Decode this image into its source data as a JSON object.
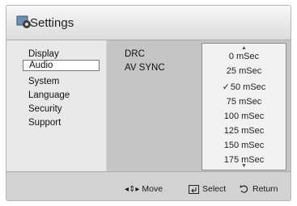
{
  "title": "Settings",
  "menu": {
    "items": [
      "Display",
      "Audio",
      "System",
      "Language",
      "Security",
      "Support"
    ],
    "selected": "Audio"
  },
  "settings": {
    "labels": [
      "DRC",
      "AV SYNC"
    ]
  },
  "dropdown": {
    "options": [
      "0 mSec",
      "25 mSec",
      "50 mSec",
      "75 mSec",
      "100 mSec",
      "125 mSec",
      "150 mSec",
      "175 mSec"
    ],
    "checked": "50 mSec",
    "check_mark": "✓",
    "up_arrow": "▲",
    "down_arrow": "▼"
  },
  "footer": {
    "move_icon": "◂⇕▸",
    "move_label": "Move",
    "select_label": "Select",
    "return_label": "Return"
  },
  "icons": {
    "title": "settings-gear-icon",
    "select": "enter-key-icon",
    "return": "return-arrow-icon"
  }
}
